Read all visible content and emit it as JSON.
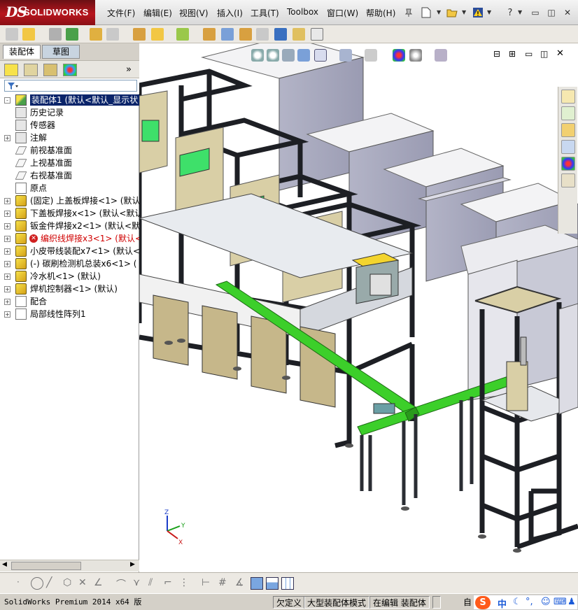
{
  "app": {
    "logo_ds": "DS",
    "logo_name": "SOLIDWORKS"
  },
  "menu": [
    "文件(F)",
    "编辑(E)",
    "视图(V)",
    "插入(I)",
    "工具(T)",
    "Toolbox",
    "窗口(W)",
    "帮助(H)"
  ],
  "title_icons": [
    "pin-icon",
    "new-doc-icon",
    "open-folder-icon",
    "warning-icon",
    "help-icon"
  ],
  "window_controls": [
    "minimize-icon",
    "restore-icon",
    "close-icon"
  ],
  "panel_tabs": {
    "assembly": "装配体",
    "sketch": "草图"
  },
  "tree": [
    {
      "label": "装配体1  (默认<默认_显示状",
      "icon": "assembly-icon",
      "selected": true,
      "expander": "-",
      "error": true
    },
    {
      "label": "历史记录",
      "icon": "history-icon"
    },
    {
      "label": "传感器",
      "icon": "sensor-icon"
    },
    {
      "label": "注解",
      "icon": "annotation-icon",
      "expander": "+"
    },
    {
      "label": "前视基准面",
      "icon": "plane-icon"
    },
    {
      "label": "上视基准面",
      "icon": "plane-icon"
    },
    {
      "label": "右视基准面",
      "icon": "plane-icon"
    },
    {
      "label": "原点",
      "icon": "origin-icon"
    },
    {
      "label": "(固定) 上盖板焊接<1> (默认",
      "icon": "part-icon",
      "expander": "+"
    },
    {
      "label": "下盖板焊接x<1> (默认<默认_",
      "icon": "part-icon",
      "expander": "+"
    },
    {
      "label": "钣金件焊接x2<1> (默认<默认",
      "icon": "part-icon",
      "expander": "+"
    },
    {
      "label": "编织线焊接x3<1> (默认<默",
      "icon": "part-icon",
      "expander": "+",
      "error": true
    },
    {
      "label": "小皮带线装配x7<1> (默认<默",
      "icon": "part-icon",
      "expander": "+"
    },
    {
      "label": "(-) 碳刷检测机总装x6<1> (",
      "icon": "part-icon",
      "expander": "+"
    },
    {
      "label": "冷水机<1> (默认)",
      "icon": "part-icon",
      "expander": "+"
    },
    {
      "label": "焊机控制器<1> (默认)",
      "icon": "part-icon",
      "expander": "+"
    },
    {
      "label": "配合",
      "icon": "mates-icon",
      "expander": "+"
    },
    {
      "label": "局部线性阵列1",
      "icon": "pattern-icon",
      "expander": "+"
    }
  ],
  "triad": {
    "x": "X",
    "y": "Y",
    "z": "Z"
  },
  "status": {
    "version": "SolidWorks Premium 2014 x64 版",
    "defined": "欠定义",
    "mode": "大型装配体模式",
    "editing": "在编辑 装配体",
    "right": "自"
  },
  "ime": {
    "lang": "中"
  },
  "colors": {
    "accent_red": "#b8151d",
    "selection": "#0a246a",
    "conveyor_green": "#3ccf2a",
    "frame_dark": "#2a2d33",
    "panel_beige": "#d9cfa6"
  }
}
